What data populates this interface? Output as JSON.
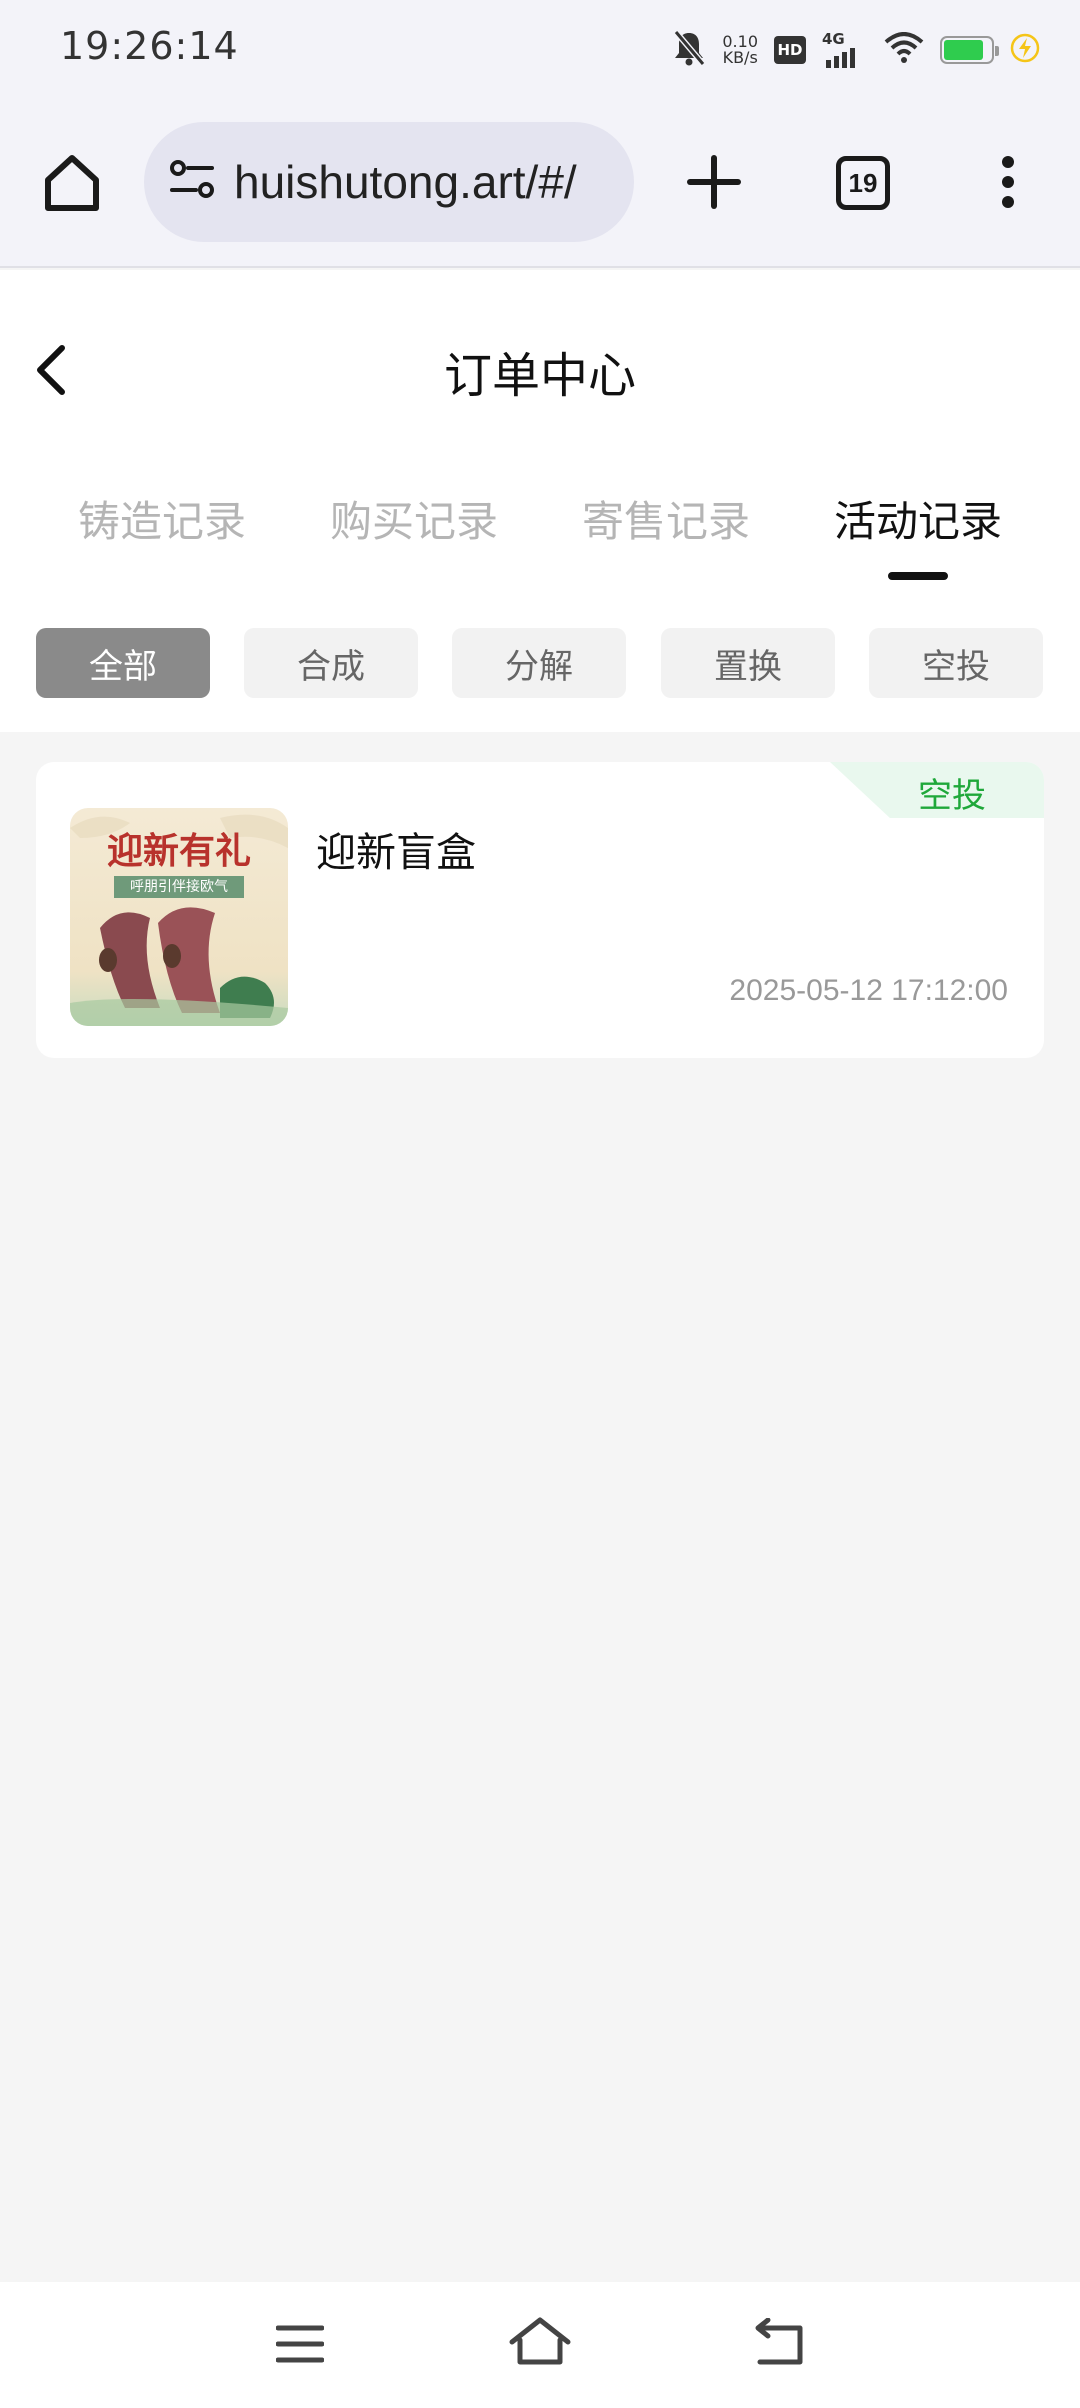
{
  "status_bar": {
    "time": "19:26:14",
    "net_speed_value": "0.10",
    "net_speed_unit": "KB/s",
    "hd_label": "HD",
    "network_label": "4G",
    "battery_level": 0.85,
    "battery_color": "#2fcc4e"
  },
  "browser": {
    "url": "huishutong.art/#/",
    "tab_count": "19"
  },
  "page": {
    "title": "订单中心",
    "tabs": [
      {
        "label": "铸造记录"
      },
      {
        "label": "购买记录"
      },
      {
        "label": "寄售记录"
      },
      {
        "label": "活动记录"
      }
    ],
    "active_tab_index": 3,
    "filters": [
      {
        "label": "全部"
      },
      {
        "label": "合成"
      },
      {
        "label": "分解"
      },
      {
        "label": "置换"
      },
      {
        "label": "空投"
      }
    ],
    "active_filter_index": 0
  },
  "records": [
    {
      "title": "迎新盲盒",
      "badge": "空投",
      "time": "2025-05-12 17:12:00",
      "thumb_headline": "迎新有礼",
      "thumb_subline": "呼朋引伴接欧气"
    }
  ],
  "colors": {
    "accent_badge_text": "#1fa83a",
    "accent_badge_bg": "#e9f8ee",
    "filter_active_bg": "#8a8a8a"
  }
}
